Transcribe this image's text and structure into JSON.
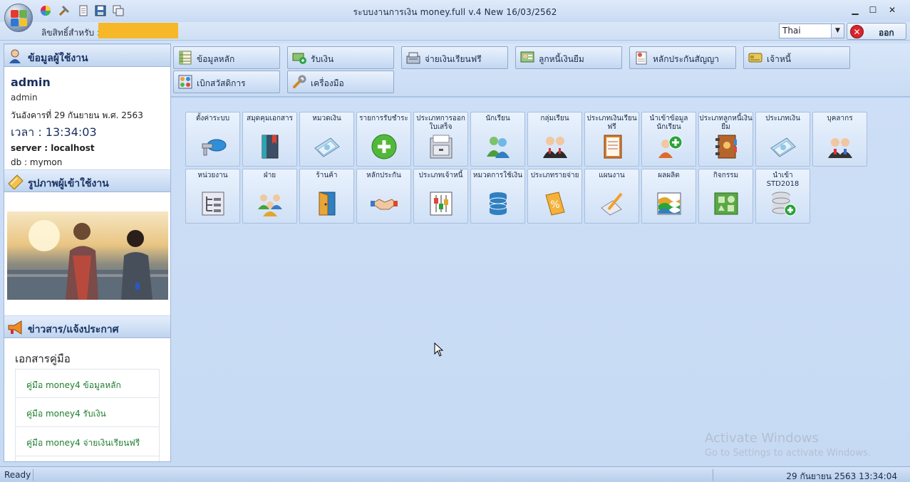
{
  "window": {
    "title": "ระบบงานการเงิน  money.full  v.4  New    16/03/2562",
    "min": "▁",
    "max": "☐",
    "close": "✕"
  },
  "license": {
    "label": "ลิขสิทธิ์สำหรับ :",
    "value": ""
  },
  "language": {
    "selected": "Thai"
  },
  "exit_label": "ออก",
  "user_panel": {
    "header": "ข้อมูลผู้ใช้งาน",
    "name": "admin",
    "role": "admin",
    "date": "วันอังคารที่ 29 กันยายน พ.ศ. 2563",
    "time": "เวลา  : 13:34:03",
    "server": "server : localhost",
    "db": "db : mymon"
  },
  "photo_panel": {
    "header": "รูปภาพผู้เข้าใช้งาน"
  },
  "news_panel": {
    "header": "ข่าวสาร/แจ้งประกาศ",
    "docs_title": "เอกสารคู่มือ",
    "docs": [
      "คู่มือ money4 ข้อมูลหลัก",
      "คู่มือ money4 รับเงิน",
      "คู่มือ money4 จ่ายเงินเรียนฟรี"
    ]
  },
  "ribbon": [
    {
      "label": "ข้อมูลหลัก",
      "icon": "table-icon"
    },
    {
      "label": "รับเงิน",
      "icon": "receive-money-icon"
    },
    {
      "label": "จ่ายเงินเรียนฟรี",
      "icon": "cash-register-icon"
    },
    {
      "label": "ลูกหนี้เงินยืม",
      "icon": "debtor-icon"
    },
    {
      "label": "หลักประกันสัญญา",
      "icon": "contract-icon"
    },
    {
      "label": "เจ้าหนี้",
      "icon": "credit-card-icon"
    },
    {
      "label": "เบิกสวัสดิการ",
      "icon": "welfare-icon"
    },
    {
      "label": "เครื่องมือ",
      "icon": "wrench-icon"
    }
  ],
  "tiles": [
    {
      "label": "ตั้งค่าระบบ",
      "icon": "key-icon"
    },
    {
      "label": "สมุดคุมเอกสาร",
      "icon": "book-icon"
    },
    {
      "label": "หมวดเงิน",
      "icon": "money-icon"
    },
    {
      "label": "รายการรับชำระ",
      "icon": "add-circle-icon"
    },
    {
      "label": "ประเภทการออกใบเสร็จ",
      "icon": "cabinet-icon"
    },
    {
      "label": "นักเรียน",
      "icon": "students-icon"
    },
    {
      "label": "กลุ่มเรียน",
      "icon": "group-icon"
    },
    {
      "label": "ประเภทเงินเรียนฟรี",
      "icon": "notebook-icon"
    },
    {
      "label": "นำเข้าข้อมูลนักเรียน",
      "icon": "import-student-icon"
    },
    {
      "label": "ประเภทลูกหนี้เงินยืม",
      "icon": "address-book-icon"
    },
    {
      "label": "ประเภทเงิน",
      "icon": "money-icon"
    },
    {
      "label": "บุคลากร",
      "icon": "staff-icon"
    },
    {
      "label": "หน่วยงาน",
      "icon": "org-chart-icon"
    },
    {
      "label": "ฝ่าย",
      "icon": "department-icon"
    },
    {
      "label": "ร้านค้า",
      "icon": "store-door-icon"
    },
    {
      "label": "หลักประกัน",
      "icon": "handshake-icon"
    },
    {
      "label": "ประเภทเจ้าหนี้",
      "icon": "equalizer-icon"
    },
    {
      "label": "หมวดการใช้เงิน",
      "icon": "database-icon"
    },
    {
      "label": "ประเภทรายจ่าย",
      "icon": "percent-icon"
    },
    {
      "label": "แผนงาน",
      "icon": "pencil-icon"
    },
    {
      "label": "ผลผลิต",
      "icon": "wave-chart-icon"
    },
    {
      "label": "กิจกรรม",
      "icon": "shapes-icon"
    },
    {
      "label": "นำเข้า STD2018",
      "icon": "database-add-icon"
    }
  ],
  "status": {
    "left": "Ready",
    "right": "29 กันยายน 2563 13:34:04"
  },
  "watermark": {
    "line1": "Activate Windows",
    "line2": "Go to Settings to activate Windows."
  }
}
